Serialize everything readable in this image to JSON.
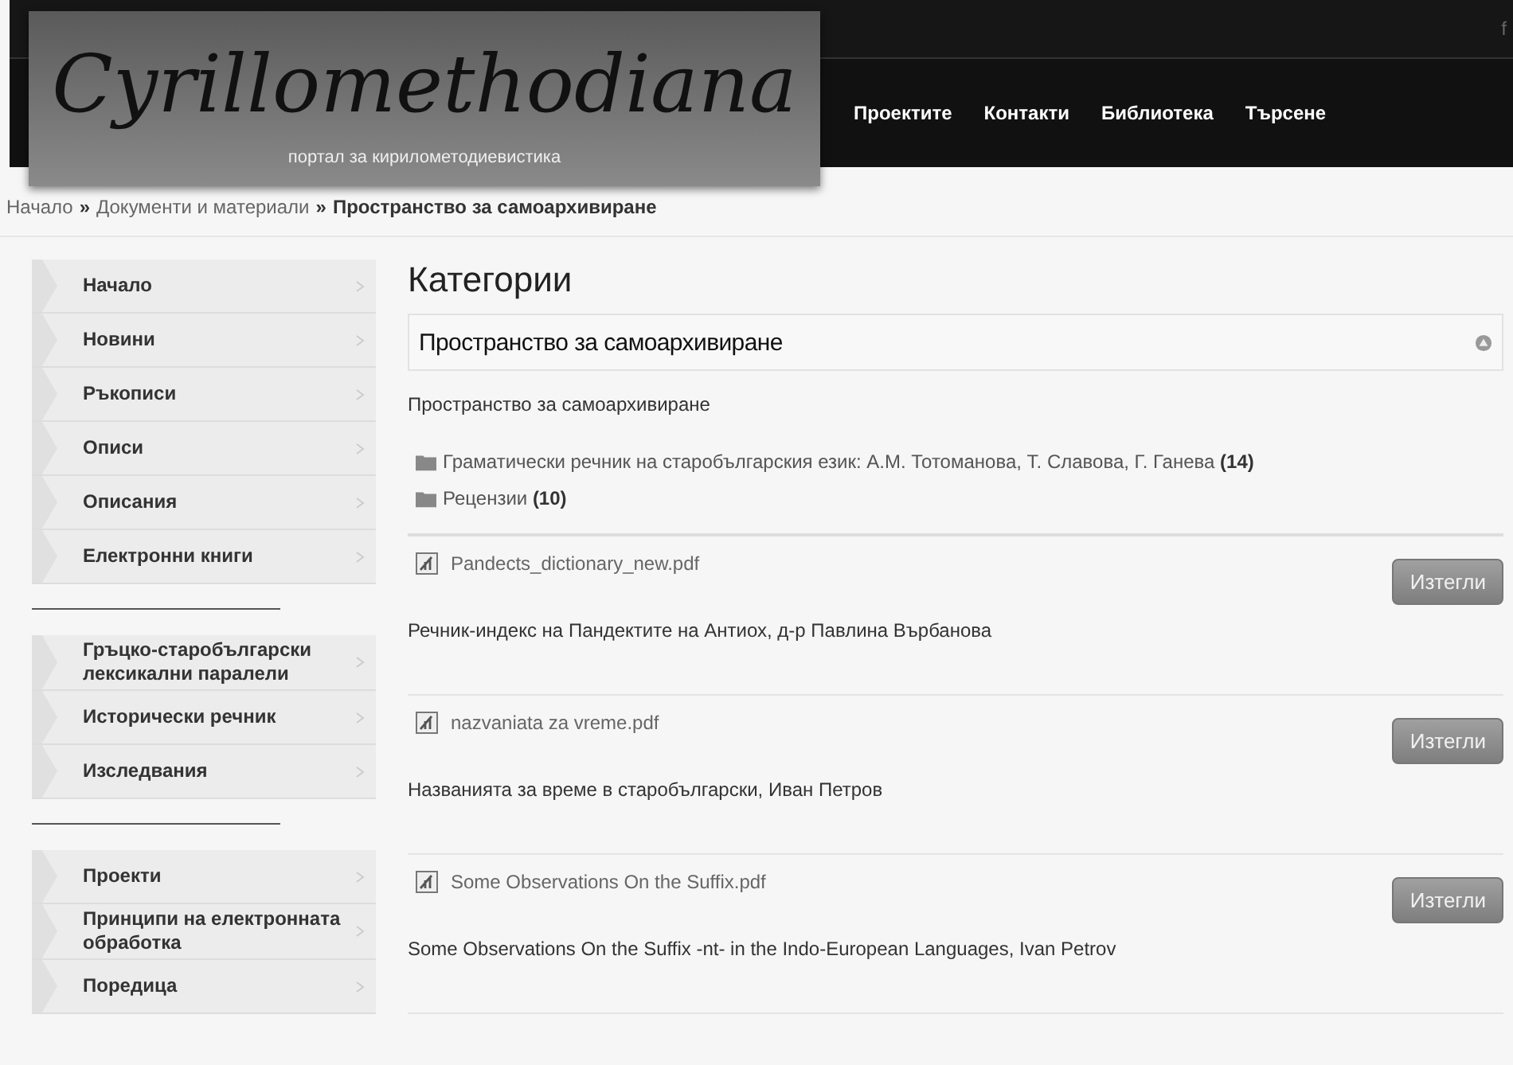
{
  "header": {
    "social": "f",
    "logo": {
      "title": "Cyrillomethodiana",
      "subtitle": "портал за кирилометодиевистика"
    },
    "nav": [
      {
        "label": "Проектите"
      },
      {
        "label": "Контакти"
      },
      {
        "label": "Библиотека"
      },
      {
        "label": "Търсене"
      }
    ]
  },
  "breadcrumb": [
    {
      "label": "Начало",
      "current": false
    },
    {
      "separator": "»",
      "label": "Документи и материали",
      "current": false
    },
    {
      "separator": "»",
      "label": "Пространство за самоархивиране",
      "current": true
    }
  ],
  "sidebar": {
    "groups": [
      [
        {
          "label": "Начало"
        },
        {
          "label": "Новини"
        },
        {
          "label": "Ръкописи"
        },
        {
          "label": "Описи"
        },
        {
          "label": "Описания"
        },
        {
          "label": "Електронни книги"
        }
      ],
      [
        {
          "label": "Гръцко-старобългарски лексикални паралели"
        },
        {
          "label": "Исторически речник"
        },
        {
          "label": "Изследвания"
        }
      ],
      [
        {
          "label": "Проекти"
        },
        {
          "label": "Принципи на електронната обработка"
        },
        {
          "label": "Поредица"
        }
      ]
    ]
  },
  "main": {
    "heading": "Категории",
    "category_title": "Пространство за самоархивиране",
    "description": "Пространство за самоархивиране",
    "subcategories": [
      {
        "label": "Граматически речник на старобългарския език: А.М. Тотоманова, Т. Славова, Г. Ганева",
        "count": "(14)"
      },
      {
        "label": "Рецензии",
        "count": "(10)"
      }
    ],
    "documents": [
      {
        "file": "Pandects_dictionary_new.pdf",
        "button": "Изтегли",
        "description": "Речник-индекс на Пандектите на Антиох, д-р Павлина Върбанова"
      },
      {
        "file": "nazvaniata za vreme.pdf",
        "button": "Изтегли",
        "description": "Названията за време в старобългарски, Иван Петров"
      },
      {
        "file": "Some Observations On the Suffix.pdf",
        "button": "Изтегли",
        "description": "Some Observations On the Suffix -nt- in the Indo-European Languages, Ivan Petrov"
      }
    ]
  }
}
